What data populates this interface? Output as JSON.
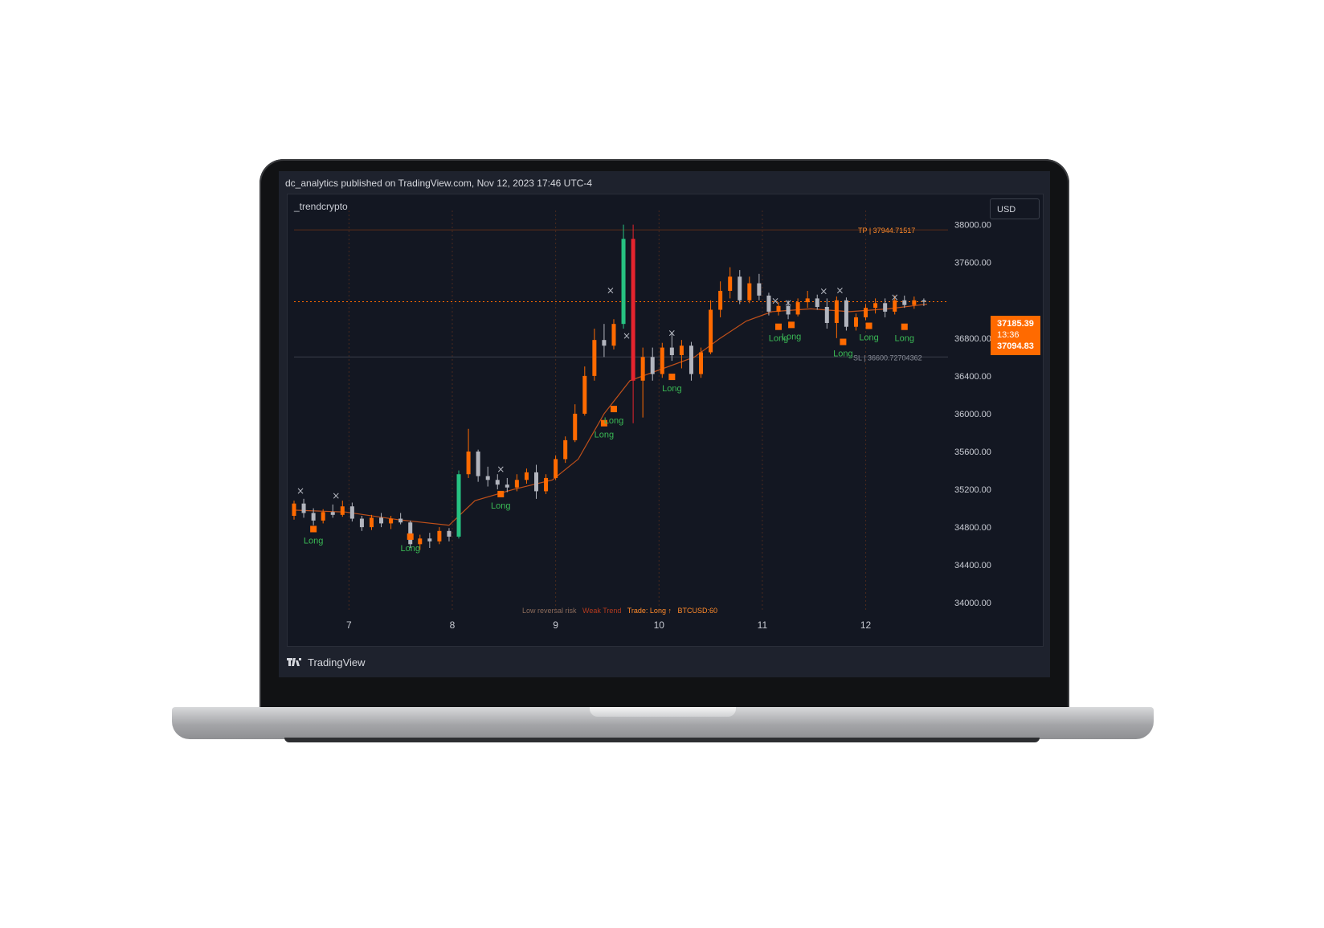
{
  "header": {
    "published_line": "dc_analytics published on TradingView.com, Nov 12, 2023 17:46 UTC-4"
  },
  "chart": {
    "name": "_trendcrypto",
    "currency_label": "USD",
    "x_labels": [
      "7",
      "8",
      "9",
      "10",
      "11",
      "12"
    ],
    "y_labels": [
      "38000.00",
      "37600.00",
      "36800.00",
      "36400.00",
      "36000.00",
      "35600.00",
      "35200.00",
      "34800.00",
      "34400.00",
      "34000.00"
    ],
    "tp_label": "TP | 37944.71517",
    "sl_label": "SL | 36600.72704362",
    "last_price": "37185.39",
    "countdown": "13:36",
    "reference_price": "37094.83",
    "signal_label": "Long",
    "exit_marker": "×",
    "status": {
      "reversal": "Low reversal risk",
      "trend": "Weak Trend",
      "trade": "Trade: Long ↑",
      "symbol": "BTCUSD:60"
    },
    "colors": {
      "background": "#131722",
      "up": "#ff6a00",
      "down": "#b2b5be",
      "strong_up": "#26c281",
      "strong_down": "#e5242e",
      "ema": "#c0501a",
      "signal_text": "#3aba55",
      "signal_marker": "#ff6a00"
    }
  },
  "chart_data": {
    "type": "candlestick",
    "x_domain": [
      0,
      100
    ],
    "ylim": [
      33900,
      38150
    ],
    "y_ticks": [
      38000,
      37600,
      36800,
      36400,
      36000,
      35600,
      35200,
      34800,
      34400,
      34000
    ],
    "x_ticks": [
      {
        "label": "7",
        "x": 8.5
      },
      {
        "label": "8",
        "x": 24.5
      },
      {
        "label": "9",
        "x": 40.5
      },
      {
        "label": "10",
        "x": 56.5
      },
      {
        "label": "11",
        "x": 72.5
      },
      {
        "label": "12",
        "x": 88.5
      }
    ],
    "series": [
      {
        "x": 0.0,
        "o": 34920,
        "h": 35080,
        "l": 34880,
        "c": 35050
      },
      {
        "x": 1.5,
        "o": 35050,
        "h": 35100,
        "l": 34900,
        "c": 34950
      },
      {
        "x": 3.0,
        "o": 34950,
        "h": 35000,
        "l": 34820,
        "c": 34870
      },
      {
        "x": 4.5,
        "o": 34870,
        "h": 34990,
        "l": 34840,
        "c": 34960
      },
      {
        "x": 6.0,
        "o": 34960,
        "h": 35040,
        "l": 34900,
        "c": 34930
      },
      {
        "x": 7.5,
        "o": 34930,
        "h": 35080,
        "l": 34910,
        "c": 35020
      },
      {
        "x": 9.0,
        "o": 35020,
        "h": 35060,
        "l": 34860,
        "c": 34890
      },
      {
        "x": 10.5,
        "o": 34890,
        "h": 34920,
        "l": 34760,
        "c": 34800
      },
      {
        "x": 12.0,
        "o": 34800,
        "h": 34930,
        "l": 34770,
        "c": 34900
      },
      {
        "x": 13.5,
        "o": 34900,
        "h": 34950,
        "l": 34800,
        "c": 34840
      },
      {
        "x": 15.0,
        "o": 34840,
        "h": 34920,
        "l": 34780,
        "c": 34890
      },
      {
        "x": 16.5,
        "o": 34890,
        "h": 34950,
        "l": 34830,
        "c": 34850
      },
      {
        "x": 18.0,
        "o": 34850,
        "h": 34870,
        "l": 34580,
        "c": 34620
      },
      {
        "x": 19.5,
        "o": 34620,
        "h": 34720,
        "l": 34560,
        "c": 34680
      },
      {
        "x": 21.0,
        "o": 34680,
        "h": 34740,
        "l": 34580,
        "c": 34650
      },
      {
        "x": 22.5,
        "o": 34650,
        "h": 34800,
        "l": 34620,
        "c": 34760
      },
      {
        "x": 24.0,
        "o": 34760,
        "h": 34790,
        "l": 34650,
        "c": 34700
      },
      {
        "x": 25.5,
        "o": 34700,
        "h": 35400,
        "l": 34680,
        "c": 35360
      },
      {
        "x": 27.0,
        "o": 35360,
        "h": 35840,
        "l": 35320,
        "c": 35600
      },
      {
        "x": 28.5,
        "o": 35600,
        "h": 35620,
        "l": 35280,
        "c": 35340
      },
      {
        "x": 30.0,
        "o": 35340,
        "h": 35440,
        "l": 35230,
        "c": 35300
      },
      {
        "x": 31.5,
        "o": 35300,
        "h": 35360,
        "l": 35200,
        "c": 35250
      },
      {
        "x": 33.0,
        "o": 35250,
        "h": 35320,
        "l": 35170,
        "c": 35220
      },
      {
        "x": 34.5,
        "o": 35220,
        "h": 35360,
        "l": 35180,
        "c": 35300
      },
      {
        "x": 36.0,
        "o": 35300,
        "h": 35420,
        "l": 35260,
        "c": 35380
      },
      {
        "x": 37.5,
        "o": 35380,
        "h": 35460,
        "l": 35100,
        "c": 35180
      },
      {
        "x": 39.0,
        "o": 35180,
        "h": 35360,
        "l": 35150,
        "c": 35320
      },
      {
        "x": 40.5,
        "o": 35320,
        "h": 35560,
        "l": 35300,
        "c": 35520
      },
      {
        "x": 42.0,
        "o": 35520,
        "h": 35760,
        "l": 35480,
        "c": 35720
      },
      {
        "x": 43.5,
        "o": 35720,
        "h": 36100,
        "l": 35700,
        "c": 36000
      },
      {
        "x": 45.0,
        "o": 36000,
        "h": 36500,
        "l": 35980,
        "c": 36400
      },
      {
        "x": 46.5,
        "o": 36400,
        "h": 36900,
        "l": 36350,
        "c": 36780
      },
      {
        "x": 48.0,
        "o": 36780,
        "h": 36950,
        "l": 36600,
        "c": 36720
      },
      {
        "x": 49.5,
        "o": 36720,
        "h": 37000,
        "l": 36680,
        "c": 36950
      },
      {
        "x": 51.0,
        "o": 36950,
        "h": 38000,
        "l": 36900,
        "c": 37850
      },
      {
        "x": 52.5,
        "o": 37850,
        "h": 38000,
        "l": 35900,
        "c": 36350
      },
      {
        "x": 54.0,
        "o": 36350,
        "h": 36700,
        "l": 35960,
        "c": 36600
      },
      {
        "x": 55.5,
        "o": 36600,
        "h": 36700,
        "l": 36350,
        "c": 36420
      },
      {
        "x": 57.0,
        "o": 36420,
        "h": 36750,
        "l": 36380,
        "c": 36700
      },
      {
        "x": 58.5,
        "o": 36700,
        "h": 36860,
        "l": 36560,
        "c": 36620
      },
      {
        "x": 60.0,
        "o": 36620,
        "h": 36780,
        "l": 36480,
        "c": 36720
      },
      {
        "x": 61.5,
        "o": 36720,
        "h": 36760,
        "l": 36350,
        "c": 36420
      },
      {
        "x": 63.0,
        "o": 36420,
        "h": 36700,
        "l": 36380,
        "c": 36650
      },
      {
        "x": 64.5,
        "o": 36650,
        "h": 37200,
        "l": 36630,
        "c": 37100
      },
      {
        "x": 66.0,
        "o": 37100,
        "h": 37400,
        "l": 37020,
        "c": 37300
      },
      {
        "x": 67.5,
        "o": 37300,
        "h": 37550,
        "l": 37220,
        "c": 37450
      },
      {
        "x": 69.0,
        "o": 37450,
        "h": 37520,
        "l": 37160,
        "c": 37200
      },
      {
        "x": 70.5,
        "o": 37200,
        "h": 37450,
        "l": 37170,
        "c": 37380
      },
      {
        "x": 72.0,
        "o": 37380,
        "h": 37480,
        "l": 37200,
        "c": 37250
      },
      {
        "x": 73.5,
        "o": 37250,
        "h": 37280,
        "l": 37040,
        "c": 37080
      },
      {
        "x": 75.0,
        "o": 37080,
        "h": 37180,
        "l": 37040,
        "c": 37140
      },
      {
        "x": 76.5,
        "o": 37140,
        "h": 37200,
        "l": 37000,
        "c": 37050
      },
      {
        "x": 78.0,
        "o": 37050,
        "h": 37220,
        "l": 37030,
        "c": 37180
      },
      {
        "x": 79.5,
        "o": 37180,
        "h": 37300,
        "l": 37120,
        "c": 37220
      },
      {
        "x": 81.0,
        "o": 37220,
        "h": 37260,
        "l": 37100,
        "c": 37130
      },
      {
        "x": 82.5,
        "o": 37130,
        "h": 37220,
        "l": 36900,
        "c": 36960
      },
      {
        "x": 84.0,
        "o": 36960,
        "h": 37240,
        "l": 36800,
        "c": 37200
      },
      {
        "x": 85.5,
        "o": 37200,
        "h": 37230,
        "l": 36880,
        "c": 36920
      },
      {
        "x": 87.0,
        "o": 36920,
        "h": 37060,
        "l": 36880,
        "c": 37020
      },
      {
        "x": 88.5,
        "o": 37020,
        "h": 37160,
        "l": 36990,
        "c": 37120
      },
      {
        "x": 90.0,
        "o": 37120,
        "h": 37220,
        "l": 37060,
        "c": 37170
      },
      {
        "x": 91.5,
        "o": 37170,
        "h": 37220,
        "l": 37020,
        "c": 37080
      },
      {
        "x": 93.0,
        "o": 37080,
        "h": 37250,
        "l": 37050,
        "c": 37200
      },
      {
        "x": 94.5,
        "o": 37200,
        "h": 37250,
        "l": 37120,
        "c": 37150
      },
      {
        "x": 96.0,
        "o": 37150,
        "h": 37240,
        "l": 37110,
        "c": 37200
      },
      {
        "x": 97.5,
        "o": 37200,
        "h": 37220,
        "l": 37140,
        "c": 37185
      }
    ],
    "ema": [
      {
        "x": 0,
        "y": 34980
      },
      {
        "x": 8,
        "y": 34960
      },
      {
        "x": 16,
        "y": 34880
      },
      {
        "x": 24,
        "y": 34820
      },
      {
        "x": 28,
        "y": 35080
      },
      {
        "x": 34,
        "y": 35200
      },
      {
        "x": 40,
        "y": 35300
      },
      {
        "x": 44,
        "y": 35520
      },
      {
        "x": 48,
        "y": 36000
      },
      {
        "x": 52,
        "y": 36350
      },
      {
        "x": 56,
        "y": 36450
      },
      {
        "x": 62,
        "y": 36600
      },
      {
        "x": 66,
        "y": 36800
      },
      {
        "x": 70,
        "y": 36980
      },
      {
        "x": 74,
        "y": 37080
      },
      {
        "x": 80,
        "y": 37110
      },
      {
        "x": 86,
        "y": 37080
      },
      {
        "x": 92,
        "y": 37110
      },
      {
        "x": 98,
        "y": 37160
      }
    ],
    "signals": [
      {
        "x": 3.0,
        "y": 34780
      },
      {
        "x": 18.0,
        "y": 34700
      },
      {
        "x": 32.0,
        "y": 35150
      },
      {
        "x": 48.0,
        "y": 35900
      },
      {
        "x": 49.5,
        "y": 36050
      },
      {
        "x": 58.5,
        "y": 36390
      },
      {
        "x": 75.0,
        "y": 36920
      },
      {
        "x": 77.0,
        "y": 36940
      },
      {
        "x": 85.0,
        "y": 36760
      },
      {
        "x": 89.0,
        "y": 36930
      },
      {
        "x": 94.5,
        "y": 36920
      }
    ],
    "exits": [
      {
        "x": 1.0,
        "y": 35150
      },
      {
        "x": 6.5,
        "y": 35100
      },
      {
        "x": 32.0,
        "y": 35380
      },
      {
        "x": 49.0,
        "y": 37270
      },
      {
        "x": 51.5,
        "y": 36790
      },
      {
        "x": 58.5,
        "y": 36820
      },
      {
        "x": 74.5,
        "y": 37160
      },
      {
        "x": 76.5,
        "y": 37140
      },
      {
        "x": 82.0,
        "y": 37260
      },
      {
        "x": 84.5,
        "y": 37270
      },
      {
        "x": 93.0,
        "y": 37200
      }
    ],
    "tp": 37944.71517,
    "sl": 36600.72704362,
    "last": 37185.39
  }
}
